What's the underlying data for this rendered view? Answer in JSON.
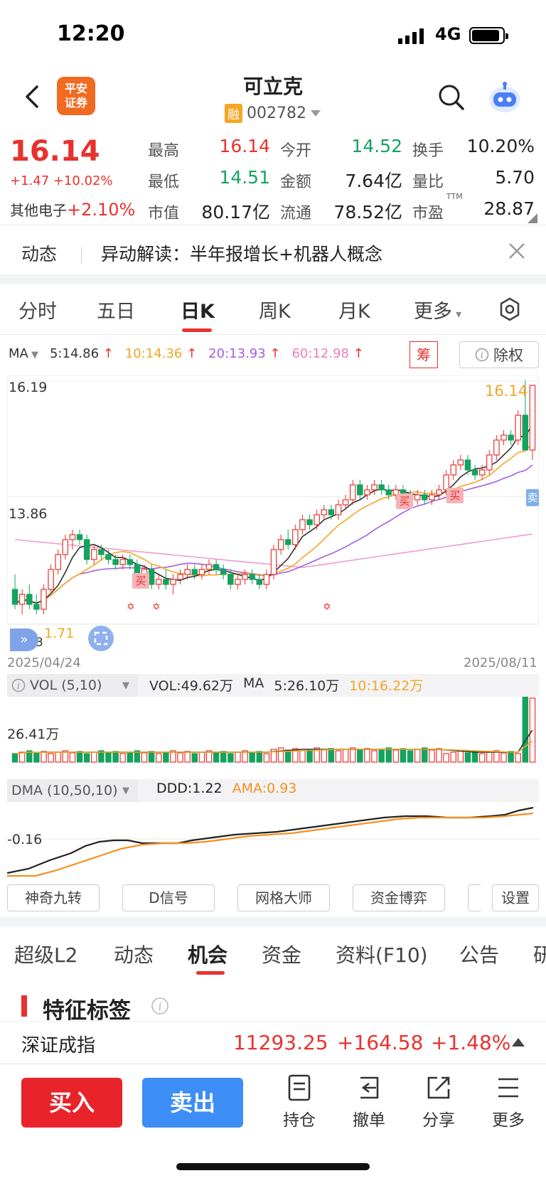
{
  "status_bar": {
    "time": "12:20",
    "network": "4G"
  },
  "header": {
    "stock_name": "可立克",
    "logo_text": [
      "平安",
      "证券"
    ],
    "badge": "融",
    "code": "002782"
  },
  "quote": {
    "price": "16.14",
    "change": "+1.47 +10.02%",
    "sector_label": "其他电子",
    "sector_change": "+2.10%",
    "fields": [
      {
        "label": "最高",
        "value": "16.14",
        "tone": "red"
      },
      {
        "label": "今开",
        "value": "14.52",
        "tone": "green"
      },
      {
        "label": "换手",
        "value": "10.20%",
        "tone": "black"
      },
      {
        "label": "最低",
        "value": "14.51",
        "tone": "green"
      },
      {
        "label": "金额",
        "value": "7.64亿",
        "tone": "black"
      },
      {
        "label": "量比",
        "value": "5.70",
        "tone": "black"
      },
      {
        "label": "市值",
        "value": "80.17亿",
        "tone": "black"
      },
      {
        "label": "流通",
        "value": "78.52亿",
        "tone": "black"
      },
      {
        "label": "市盈",
        "value": "28.87",
        "tone": "black",
        "sup": "TTM"
      }
    ]
  },
  "news": {
    "tag": "动态",
    "text": "异动解读：半年报增长+机器人概念"
  },
  "chart_tabs": [
    "分时",
    "五日",
    "日K",
    "周K",
    "月K",
    "更多"
  ],
  "chart_tab_active": "日K",
  "ma_legend": {
    "label": "MA",
    "items": [
      {
        "text": "5:14.86",
        "color": "#333333"
      },
      {
        "text": "10:14.36",
        "color": "#f5a623"
      },
      {
        "text": "20:13.93",
        "color": "#a25fe0"
      },
      {
        "text": "60:12.98",
        "color": "#f07dbd"
      }
    ],
    "chou": "筹",
    "chuquan": "除权"
  },
  "kline_labels": {
    "top": "16.19",
    "mid": "13.86",
    "low_fragment": "1.71",
    "bottom_fragment": "3",
    "last_price": "16.14",
    "buy_marker": "买",
    "sell_marker": "卖",
    "date_start": "2025/04/24",
    "date_end": "2025/08/11"
  },
  "volume": {
    "selector": "VOL (5,10)",
    "vol": "VOL:49.62万",
    "ma_label": "MA",
    "ma5": "5:26.10万",
    "ma10": "10:16.22万",
    "axis": "26.41万"
  },
  "dma": {
    "selector": "DMA (10,50,10)",
    "ddd": "DDD:1.22",
    "ama": "AMA:0.93",
    "axis": "-0.16"
  },
  "indicator_buttons": [
    "神奇九转",
    "D信号",
    "网格大师",
    "资金博弈",
    "设置"
  ],
  "bottom_tabs": [
    "超级L2",
    "动态",
    "机会",
    "资金",
    "资料(F10)",
    "公告",
    "研"
  ],
  "bottom_tab_active": "机会",
  "section": {
    "title": "特征标签"
  },
  "ticker": {
    "name": "深证成指",
    "value": "11293.25",
    "change": "+164.58",
    "pct": "+1.48%"
  },
  "actions": {
    "buy": "买入",
    "sell": "卖出",
    "items": [
      "持仓",
      "撤单",
      "分享",
      "更多"
    ]
  },
  "chart_data": {
    "type": "candlestick",
    "price_axis_labels": [
      "16.19",
      "13.86"
    ],
    "date_range": [
      "2025/04/24",
      "2025/08/11"
    ],
    "candles": [
      [
        12.0,
        12.3,
        11.6,
        11.7
      ],
      [
        11.7,
        12.0,
        11.5,
        11.9
      ],
      [
        11.9,
        12.1,
        11.6,
        11.7
      ],
      [
        11.7,
        11.9,
        11.5,
        11.6
      ],
      [
        11.6,
        12.1,
        11.5,
        12.0
      ],
      [
        12.0,
        12.5,
        11.9,
        12.4
      ],
      [
        12.4,
        12.8,
        12.3,
        12.7
      ],
      [
        12.7,
        13.1,
        12.6,
        13.0
      ],
      [
        13.0,
        13.2,
        12.8,
        13.1
      ],
      [
        13.1,
        13.2,
        12.9,
        13.0
      ],
      [
        13.0,
        13.1,
        12.5,
        12.6
      ],
      [
        12.6,
        12.9,
        12.5,
        12.8
      ],
      [
        12.8,
        12.9,
        12.6,
        12.7
      ],
      [
        12.7,
        12.8,
        12.5,
        12.6
      ],
      [
        12.6,
        12.7,
        12.4,
        12.5
      ],
      [
        12.5,
        12.7,
        12.4,
        12.6
      ],
      [
        12.6,
        12.7,
        12.4,
        12.5
      ],
      [
        12.5,
        12.6,
        12.2,
        12.3
      ],
      [
        12.3,
        12.5,
        12.1,
        12.4
      ],
      [
        12.4,
        12.5,
        12.0,
        12.1
      ],
      [
        12.1,
        12.3,
        12.0,
        12.2
      ],
      [
        12.2,
        12.4,
        12.0,
        12.1
      ],
      [
        12.1,
        12.3,
        11.9,
        12.2
      ],
      [
        12.2,
        12.4,
        12.1,
        12.3
      ],
      [
        12.3,
        12.5,
        12.2,
        12.4
      ],
      [
        12.4,
        12.5,
        12.2,
        12.3
      ],
      [
        12.3,
        12.5,
        12.2,
        12.4
      ],
      [
        12.4,
        12.6,
        12.3,
        12.5
      ],
      [
        12.5,
        12.6,
        12.3,
        12.4
      ],
      [
        12.4,
        12.5,
        12.2,
        12.3
      ],
      [
        12.3,
        12.4,
        12.0,
        12.1
      ],
      [
        12.1,
        12.3,
        12.0,
        12.2
      ],
      [
        12.2,
        12.4,
        12.1,
        12.3
      ],
      [
        12.3,
        12.4,
        12.1,
        12.2
      ],
      [
        12.2,
        12.3,
        12.0,
        12.1
      ],
      [
        12.1,
        12.4,
        12.0,
        12.3
      ],
      [
        12.3,
        12.9,
        12.2,
        12.8
      ],
      [
        12.8,
        13.1,
        12.7,
        13.0
      ],
      [
        13.0,
        13.2,
        12.8,
        12.9
      ],
      [
        12.9,
        13.3,
        12.8,
        13.2
      ],
      [
        13.2,
        13.5,
        13.1,
        13.4
      ],
      [
        13.4,
        13.5,
        13.2,
        13.3
      ],
      [
        13.3,
        13.6,
        13.2,
        13.5
      ],
      [
        13.5,
        13.7,
        13.4,
        13.6
      ],
      [
        13.6,
        13.7,
        13.4,
        13.5
      ],
      [
        13.5,
        13.8,
        13.4,
        13.7
      ],
      [
        13.7,
        13.9,
        13.6,
        13.8
      ],
      [
        13.8,
        14.2,
        13.7,
        14.1
      ],
      [
        14.1,
        14.2,
        13.8,
        13.9
      ],
      [
        13.9,
        14.1,
        13.8,
        14.0
      ],
      [
        14.0,
        14.2,
        13.9,
        14.1
      ],
      [
        14.1,
        14.2,
        13.9,
        14.0
      ],
      [
        14.0,
        14.1,
        13.8,
        13.9
      ],
      [
        13.9,
        14.1,
        13.8,
        14.0
      ],
      [
        14.0,
        14.1,
        13.8,
        13.9
      ],
      [
        13.9,
        14.0,
        13.7,
        13.8
      ],
      [
        13.8,
        14.0,
        13.7,
        13.9
      ],
      [
        13.9,
        14.0,
        13.7,
        13.8
      ],
      [
        13.8,
        14.0,
        13.7,
        13.9
      ],
      [
        13.9,
        14.1,
        13.8,
        14.0
      ],
      [
        14.0,
        14.4,
        13.9,
        14.3
      ],
      [
        14.3,
        14.6,
        14.2,
        14.5
      ],
      [
        14.5,
        14.7,
        14.4,
        14.6
      ],
      [
        14.6,
        14.7,
        14.3,
        14.4
      ],
      [
        14.4,
        14.5,
        14.2,
        14.3
      ],
      [
        14.3,
        14.5,
        14.2,
        14.4
      ],
      [
        14.4,
        14.8,
        14.3,
        14.7
      ],
      [
        14.7,
        15.1,
        14.6,
        15.0
      ],
      [
        15.0,
        15.2,
        14.9,
        15.1
      ],
      [
        15.1,
        15.2,
        14.9,
        15.0
      ],
      [
        15.0,
        15.6,
        14.9,
        15.5
      ],
      [
        15.5,
        16.2,
        15.4,
        14.8
      ],
      [
        14.8,
        16.1,
        14.6,
        16.1
      ]
    ],
    "volume_axis_label": "26.41万",
    "dma_axis_label": "-0.16"
  }
}
